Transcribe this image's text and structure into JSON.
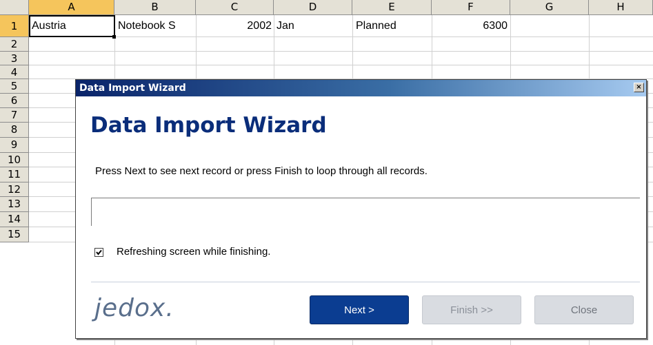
{
  "columns": [
    "A",
    "B",
    "C",
    "D",
    "E",
    "F",
    "G",
    "H"
  ],
  "rows": [
    "1",
    "2",
    "3",
    "4",
    "5",
    "6",
    "7",
    "8",
    "9",
    "10",
    "11",
    "12",
    "13",
    "14",
    "15"
  ],
  "row1": {
    "a": "Austria",
    "b": "Notebook S",
    "c": "2002",
    "d": "Jan",
    "e": "Planned",
    "f": "6300"
  },
  "dialog": {
    "titlebar": "Data Import Wizard",
    "close_glyph": "×",
    "heading": "Data Import Wizard",
    "instruction": "Press Next to see next record or press Finish to loop through all records.",
    "checkbox_label": "Refreshing screen while finishing.",
    "checkbox_checked": true,
    "logo": "jedox.",
    "buttons": {
      "next": "Next >",
      "finish": "Finish >>",
      "close": "Close"
    }
  },
  "colors": {
    "accent": "#0b3d91",
    "titlebar_start": "#0a246a",
    "titlebar_end": "#a6caf0",
    "header_highlight": "#f5c55c"
  }
}
